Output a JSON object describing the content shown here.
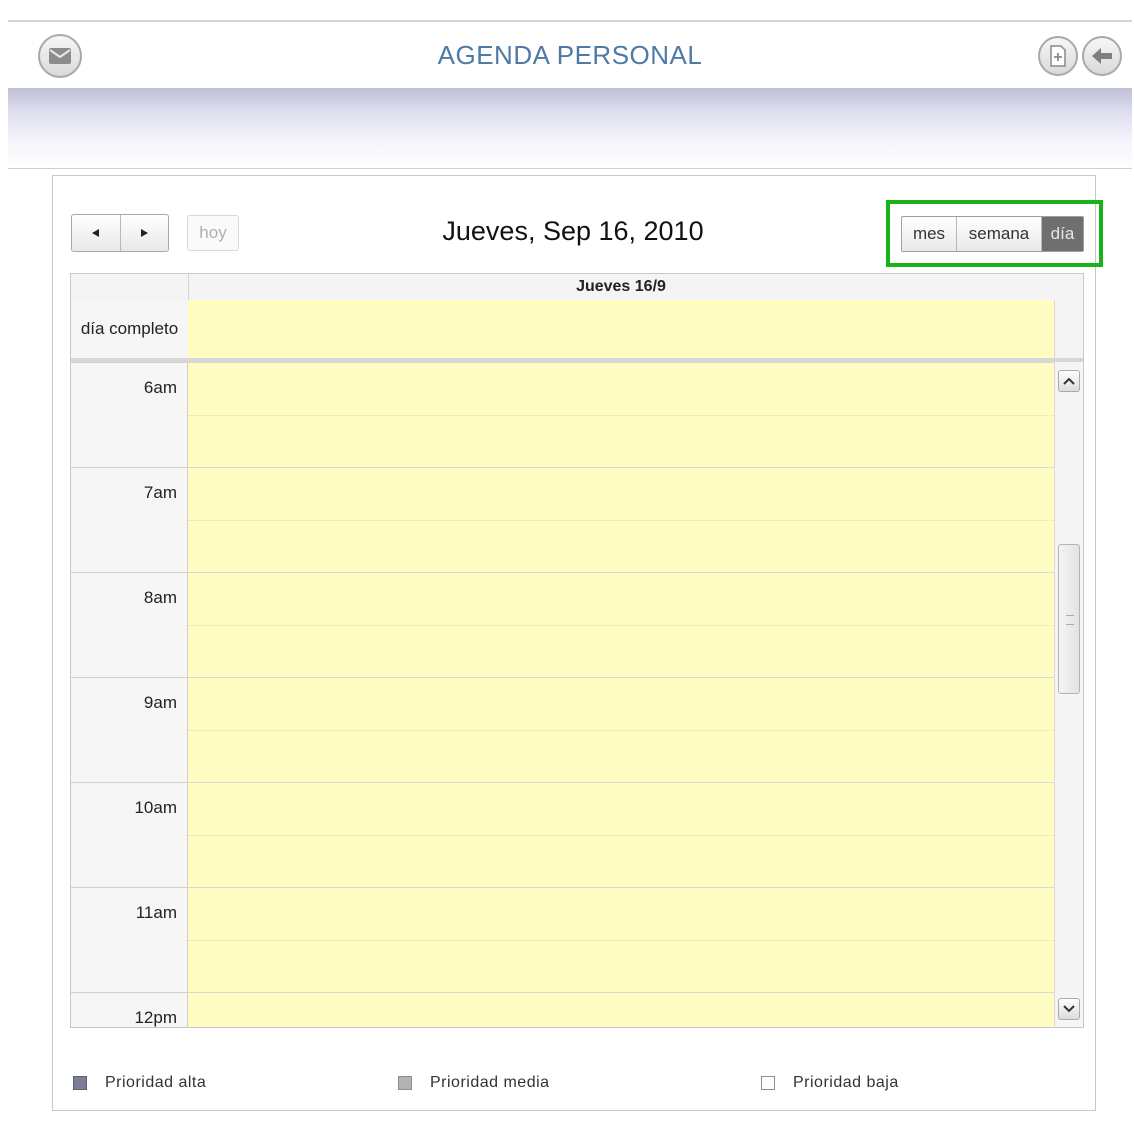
{
  "header": {
    "title": "AGENDA PERSONAL",
    "left_icon": "mail-icon",
    "right_icons": [
      "new-document-icon",
      "back-arrow-icon"
    ]
  },
  "calendar": {
    "title": "Jueves, Sep 16, 2010",
    "nav": {
      "prev_icon": "triangle-left-icon",
      "next_icon": "triangle-right-icon",
      "today_label": "hoy"
    },
    "views": {
      "month": "mes",
      "week": "semana",
      "day": "día",
      "active": "día"
    },
    "column_header": "Jueves 16/9",
    "all_day_label": "día completo",
    "hours": [
      "6am",
      "7am",
      "8am",
      "9am",
      "10am",
      "11am",
      "12pm"
    ]
  },
  "legend": {
    "high": "Prioridad alta",
    "medium": "Prioridad media",
    "low": "Prioridad baja"
  },
  "colors": {
    "title_blue": "#4f79a6",
    "slot_yellow": "#fffdc2",
    "highlight_green": "#19b319",
    "active_view": "#6f6f6f",
    "priority_high": "#7c7f94",
    "priority_medium": "#b3b3b3",
    "priority_low": "#ffffff"
  }
}
